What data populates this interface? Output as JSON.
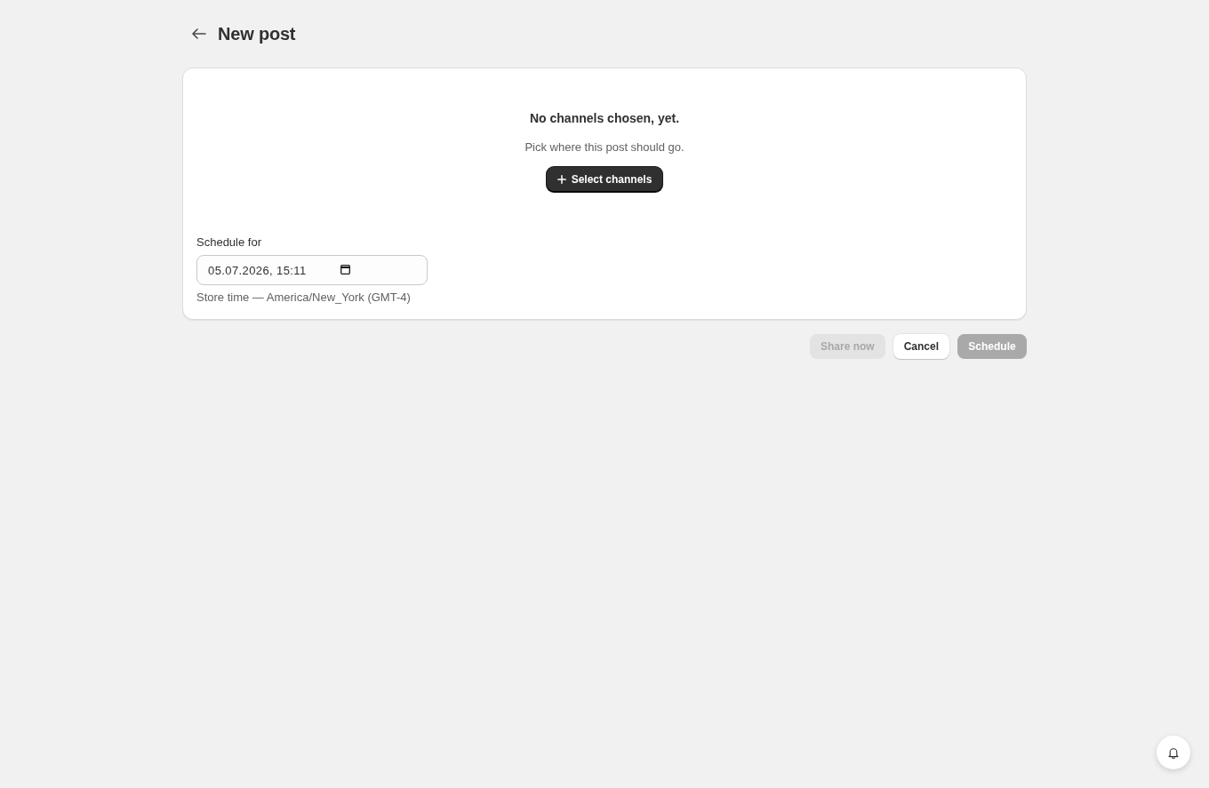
{
  "header": {
    "title": "New post"
  },
  "channels": {
    "heading": "No channels chosen, yet.",
    "description": "Pick where this post should go.",
    "button": {
      "label": "Select channels"
    }
  },
  "schedule": {
    "label": "Schedule for",
    "value": "05.07.2026, 15:11",
    "help": "Store time — America/New_York (GMT-4)"
  },
  "actions": [
    {
      "label": "Share now",
      "kind": "secondary",
      "disabled": true
    },
    {
      "label": "Cancel",
      "kind": "secondary",
      "disabled": false
    },
    {
      "label": "Schedule",
      "kind": "primary",
      "disabled": true
    }
  ]
}
